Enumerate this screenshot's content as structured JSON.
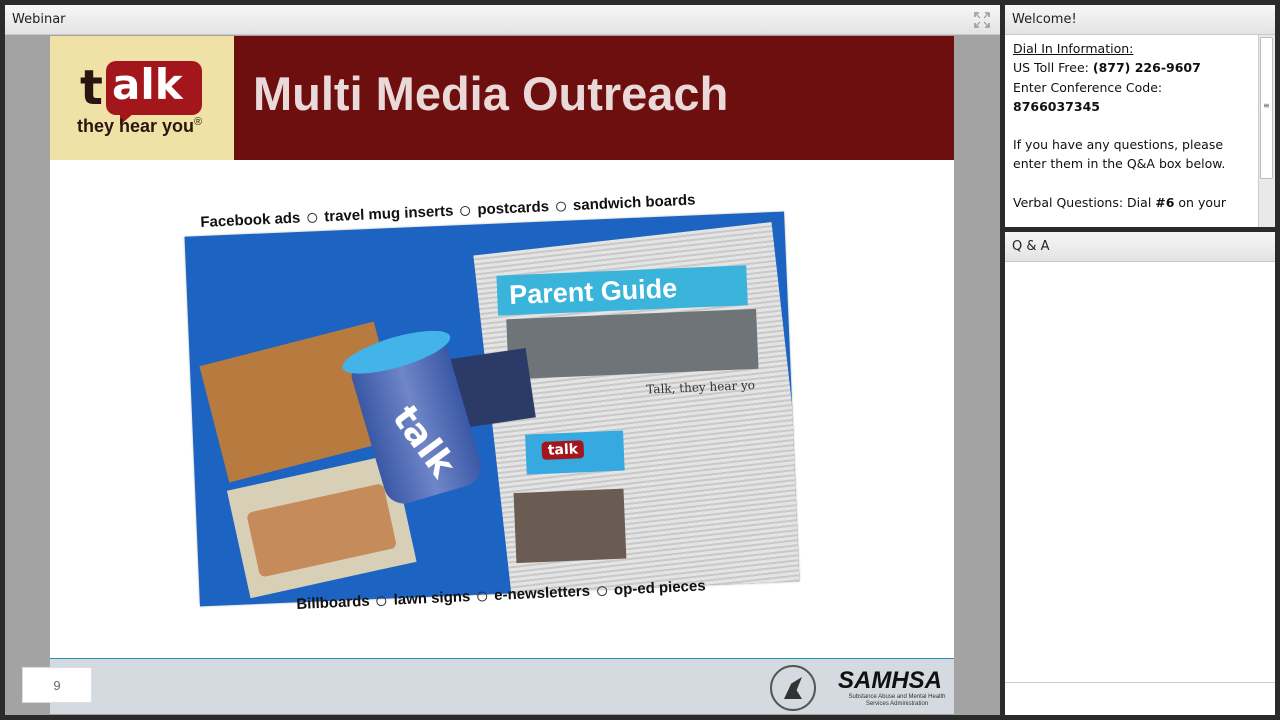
{
  "webinar": {
    "title": "Webinar",
    "slide": {
      "logo_word": "alk",
      "logo_letter": "t",
      "logo_tagline": "they hear you",
      "logo_mark": "®",
      "title": "Multi Media Outreach",
      "top_items": [
        "Facebook ads",
        "travel mug inserts",
        "postcards",
        "sandwich boards"
      ],
      "bottom_items": [
        "Billboards",
        "lawn signs",
        "e-newsletters",
        "op-ed pieces"
      ],
      "photo_banner": "Parent Guide",
      "photo_headline": "Talk, they hear yo",
      "photo_badge": "talk",
      "mug_text": "talk",
      "footer_logo": "SAMHSA",
      "footer_logo_sub": "Substance Abuse and Mental Health Services Administration",
      "page_number": "9"
    }
  },
  "welcome": {
    "title": "Welcome!",
    "dial_in_heading": "Dial In Information:",
    "toll_free_label": "US Toll Free: ",
    "toll_free_number": "(877) 226-9607",
    "conference_label": "Enter Conference Code:",
    "conference_code": "8766037345",
    "questions_text": "If you have any questions, please enter them in the Q&A box below.",
    "verbal_label": "Verbal Questions: Dial ",
    "verbal_key": "#6",
    "verbal_suffix": " on your"
  },
  "qa": {
    "title": "Q & A"
  },
  "icons": {
    "expand": "expand-icon",
    "seal": "hhs-seal-icon"
  }
}
